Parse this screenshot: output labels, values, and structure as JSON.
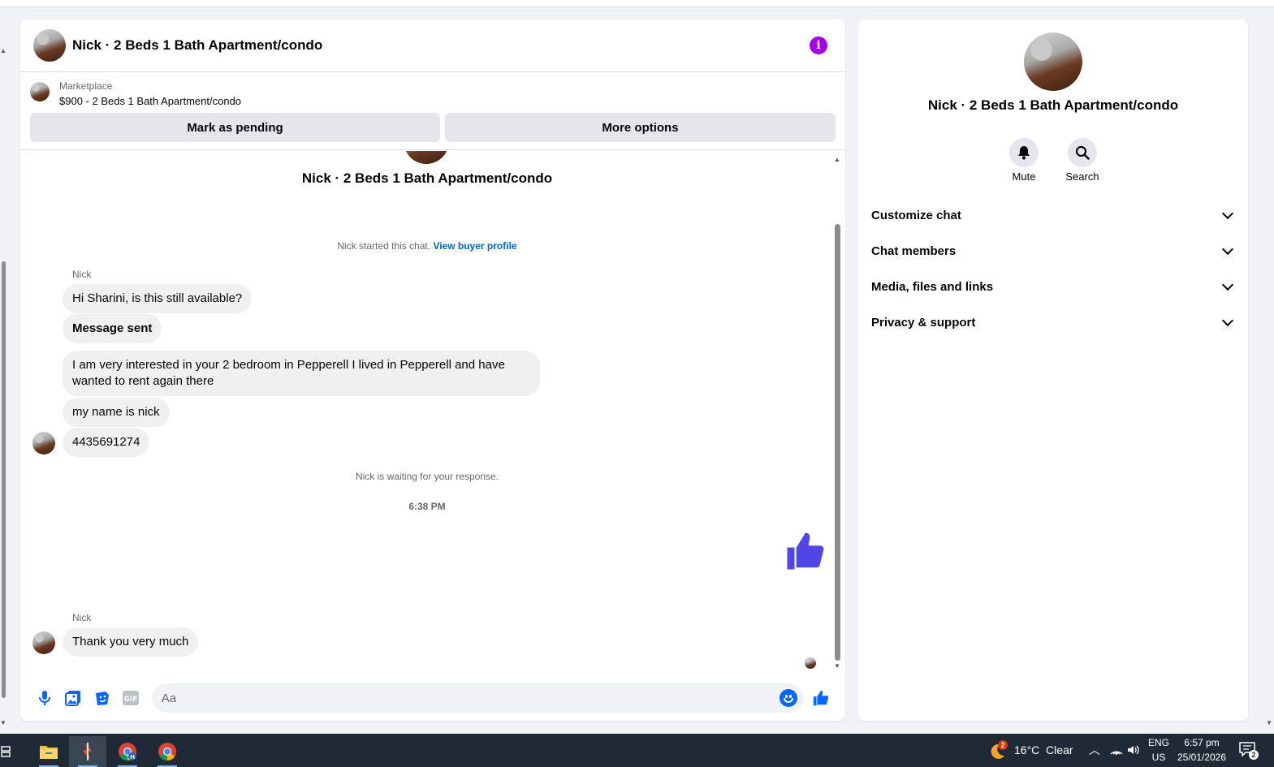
{
  "chat": {
    "title": "Nick · 2 Beds 1 Bath Apartment/condo",
    "listing": {
      "source": "Marketplace",
      "price_title": "$900 - 2 Beds 1 Bath Apartment/condo",
      "mark_pending": "Mark as pending",
      "more_options": "More options"
    },
    "conversation_title": "Nick · 2 Beds 1 Bath Apartment/condo",
    "started_text": "Nick started this chat. ",
    "view_buyer_profile": "View buyer profile",
    "messages": [
      {
        "sender": "Nick",
        "text": "Hi Sharini, is this still available?"
      },
      {
        "text": "Message sent"
      },
      {
        "text": "I am very interested in your 2 bedroom in Pepperell I lived in Pepperell and have wanted to rent again there"
      },
      {
        "text": "my name is nick"
      },
      {
        "text": "4435691274"
      }
    ],
    "waiting_text": "Nick is waiting for your response.",
    "timestamp": "6:38 PM",
    "last_sender": "Nick",
    "last_message": "Thank you very much",
    "composer": {
      "placeholder": "Aa"
    }
  },
  "side": {
    "title": "Nick · 2 Beds 1 Bath Apartment/condo",
    "actions": [
      {
        "label": "Mute",
        "icon": "bell-icon"
      },
      {
        "label": "Search",
        "icon": "search-icon"
      }
    ],
    "sections": [
      "Customize chat",
      "Chat members",
      "Media, files and links",
      "Privacy & support"
    ]
  },
  "taskbar": {
    "weather": "16°C  Clear",
    "weather_badge": "2",
    "lang_top": "ENG",
    "lang_bottom": "US",
    "time": "6:57 pm",
    "date": "25/01/2026",
    "notifications": "2"
  },
  "colors": {
    "accent": "#0866ff",
    "like": "#5046e5",
    "info": "#a400e8",
    "link": "#0064d1"
  }
}
